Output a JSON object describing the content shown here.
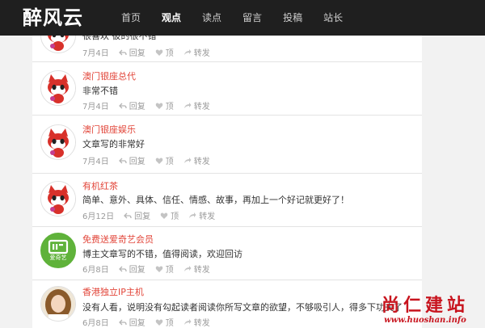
{
  "site": {
    "logo": "醉风云"
  },
  "nav": [
    "首页",
    "观点",
    "读点",
    "留言",
    "投稿",
    "站长"
  ],
  "actions": {
    "reply": "回复",
    "like": "顶",
    "forward": "转发"
  },
  "comments": [
    {
      "user": "",
      "text": "很喜欢 彼的很不错",
      "date": "7月4日",
      "avatar": "fox-avatar"
    },
    {
      "user": "澳门银座总代",
      "text": "非常不错",
      "date": "7月4日",
      "avatar": "fox-avatar"
    },
    {
      "user": "澳门银座娱乐",
      "text": "文章写的非常好",
      "date": "7月4日",
      "avatar": "fox-avatar"
    },
    {
      "user": "有机红茶",
      "text": "简单、意外、具体、信任、情感、故事，再加上一个好记就更好了！",
      "date": "6月12日",
      "avatar": "fox-avatar"
    },
    {
      "user": "免费送爱奇艺会员",
      "text": "博主文章写的不错，值得阅读，欢迎回访",
      "date": "6月8日",
      "avatar": "iqiyi-avatar",
      "avatar_caption": "爱奇艺"
    },
    {
      "user": "香港独立IP主机",
      "text": "没有人看，说明没有勾起读者阅读你所写文章的欲望，不够吸引人，得多下功夫了",
      "date": "6月8日",
      "avatar": "photo-avatar"
    }
  ],
  "watermark": {
    "title": "尚仁建站",
    "url": "www.huoshan.info"
  },
  "colors": {
    "topbar": "#1f1f1f",
    "username": "#e2463a",
    "watermark": "#c8141e",
    "iqiyi": "#5fb23a"
  }
}
